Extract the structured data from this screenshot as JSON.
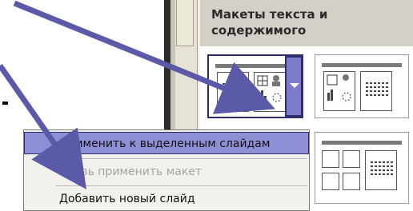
{
  "task_pane": {
    "title": "Макеты текста и содержимого"
  },
  "context_menu": {
    "items": [
      {
        "label": "Применить к выделенным слайдам",
        "state": "highlighted"
      },
      {
        "label": "Вновь применить макет",
        "state": "disabled"
      },
      {
        "label": "Добавить новый слайд",
        "state": "normal"
      }
    ]
  },
  "colors": {
    "highlight": "#8f8fd6",
    "highlight_border": "#2c2c6e",
    "arrow": "#5a5aa8",
    "pane_header": "#d4d0c8"
  },
  "icons": [
    "chevron-down-icon",
    "table-icon",
    "person-icon",
    "chart-icon",
    "clipart-icon",
    "text-lines-icon",
    "pointer-arrow-icon"
  ]
}
